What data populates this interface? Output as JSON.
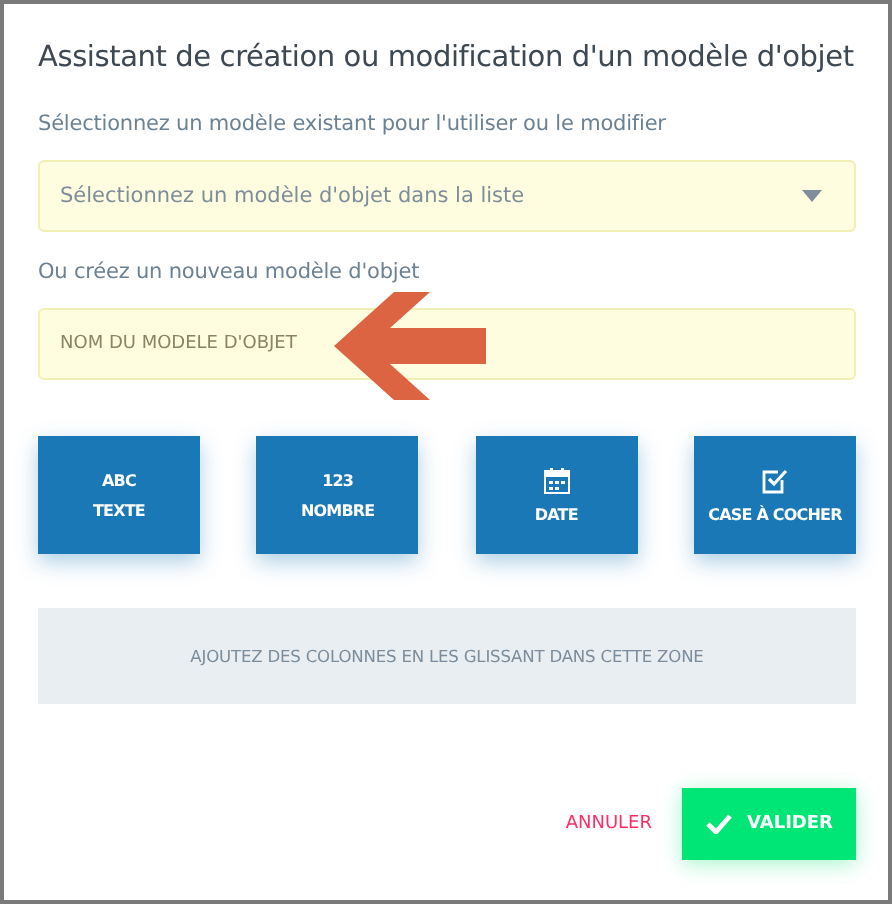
{
  "dialog": {
    "title": "Assistant de création ou modification d'un modèle d'objet"
  },
  "existing": {
    "label": "Sélectionnez un modèle existant pour l'utiliser ou le modifier",
    "placeholder": "Sélectionnez un modèle d'objet dans la liste"
  },
  "new_model": {
    "label": "Ou créez un nouveau modèle d'objet",
    "placeholder": "NOM DU MODELE D'OBJET"
  },
  "field_types": [
    {
      "kind": "glyph",
      "glyph": "ABC",
      "label": "TEXTE"
    },
    {
      "kind": "glyph",
      "glyph": "123",
      "label": "NOMBRE"
    },
    {
      "kind": "calendar",
      "label": "DATE"
    },
    {
      "kind": "checkbox",
      "label": "CASE À COCHER"
    }
  ],
  "drop_zone": {
    "text": "AJOUTEZ DES COLONNES EN LES GLISSANT DANS CETTE ZONE"
  },
  "buttons": [
    {
      "kind": "cancel",
      "label": "ANNULER"
    },
    {
      "kind": "confirm",
      "label": "VALIDER"
    }
  ]
}
